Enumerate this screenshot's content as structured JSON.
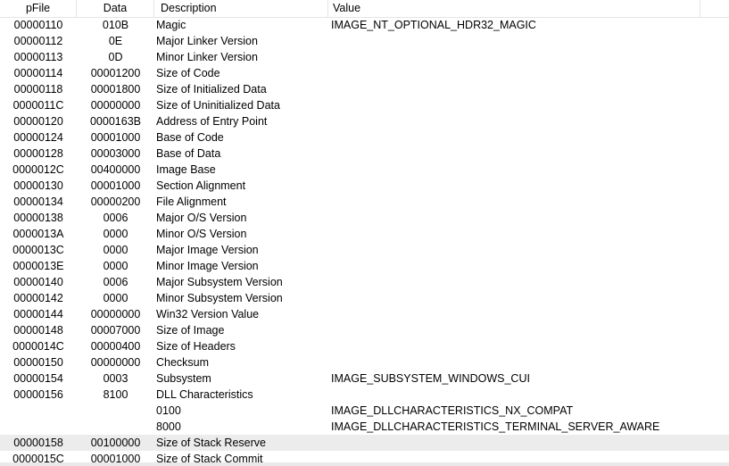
{
  "columns": {
    "pfile": "pFile",
    "data": "Data",
    "description": "Description",
    "value": "Value"
  },
  "rows": [
    {
      "pfile": "00000110",
      "data": "010B",
      "description": "Magic",
      "value": "IMAGE_NT_OPTIONAL_HDR32_MAGIC"
    },
    {
      "pfile": "00000112",
      "data": "0E",
      "description": "Major Linker Version",
      "value": ""
    },
    {
      "pfile": "00000113",
      "data": "0D",
      "description": "Minor Linker Version",
      "value": ""
    },
    {
      "pfile": "00000114",
      "data": "00001200",
      "description": "Size of Code",
      "value": ""
    },
    {
      "pfile": "00000118",
      "data": "00001800",
      "description": "Size of Initialized Data",
      "value": ""
    },
    {
      "pfile": "0000011C",
      "data": "00000000",
      "description": "Size of Uninitialized Data",
      "value": ""
    },
    {
      "pfile": "00000120",
      "data": "0000163B",
      "description": "Address of Entry Point",
      "value": ""
    },
    {
      "pfile": "00000124",
      "data": "00001000",
      "description": "Base of Code",
      "value": ""
    },
    {
      "pfile": "00000128",
      "data": "00003000",
      "description": "Base of Data",
      "value": ""
    },
    {
      "pfile": "0000012C",
      "data": "00400000",
      "description": "Image Base",
      "value": ""
    },
    {
      "pfile": "00000130",
      "data": "00001000",
      "description": "Section Alignment",
      "value": ""
    },
    {
      "pfile": "00000134",
      "data": "00000200",
      "description": "File Alignment",
      "value": ""
    },
    {
      "pfile": "00000138",
      "data": "0006",
      "description": "Major O/S Version",
      "value": ""
    },
    {
      "pfile": "0000013A",
      "data": "0000",
      "description": "Minor O/S Version",
      "value": ""
    },
    {
      "pfile": "0000013C",
      "data": "0000",
      "description": "Major Image Version",
      "value": ""
    },
    {
      "pfile": "0000013E",
      "data": "0000",
      "description": "Minor Image Version",
      "value": ""
    },
    {
      "pfile": "00000140",
      "data": "0006",
      "description": "Major Subsystem Version",
      "value": ""
    },
    {
      "pfile": "00000142",
      "data": "0000",
      "description": "Minor Subsystem Version",
      "value": ""
    },
    {
      "pfile": "00000144",
      "data": "00000000",
      "description": "Win32 Version Value",
      "value": ""
    },
    {
      "pfile": "00000148",
      "data": "00007000",
      "description": "Size of Image",
      "value": ""
    },
    {
      "pfile": "0000014C",
      "data": "00000400",
      "description": "Size of Headers",
      "value": ""
    },
    {
      "pfile": "00000150",
      "data": "00000000",
      "description": "Checksum",
      "value": ""
    },
    {
      "pfile": "00000154",
      "data": "0003",
      "description": "Subsystem",
      "value": "IMAGE_SUBSYSTEM_WINDOWS_CUI"
    },
    {
      "pfile": "00000156",
      "data": "8100",
      "description": "DLL Characteristics",
      "value": ""
    },
    {
      "pfile": "",
      "data": "",
      "description": "0100",
      "value": "IMAGE_DLLCHARACTERISTICS_NX_COMPAT"
    },
    {
      "pfile": "",
      "data": "",
      "description": "8000",
      "value": "IMAGE_DLLCHARACTERISTICS_TERMINAL_SERVER_AWARE"
    },
    {
      "pfile": "00000158",
      "data": "00100000",
      "description": "Size of Stack Reserve",
      "value": "",
      "selected": true
    },
    {
      "pfile": "0000015C",
      "data": "00001000",
      "description": "Size of Stack Commit",
      "value": ""
    }
  ]
}
